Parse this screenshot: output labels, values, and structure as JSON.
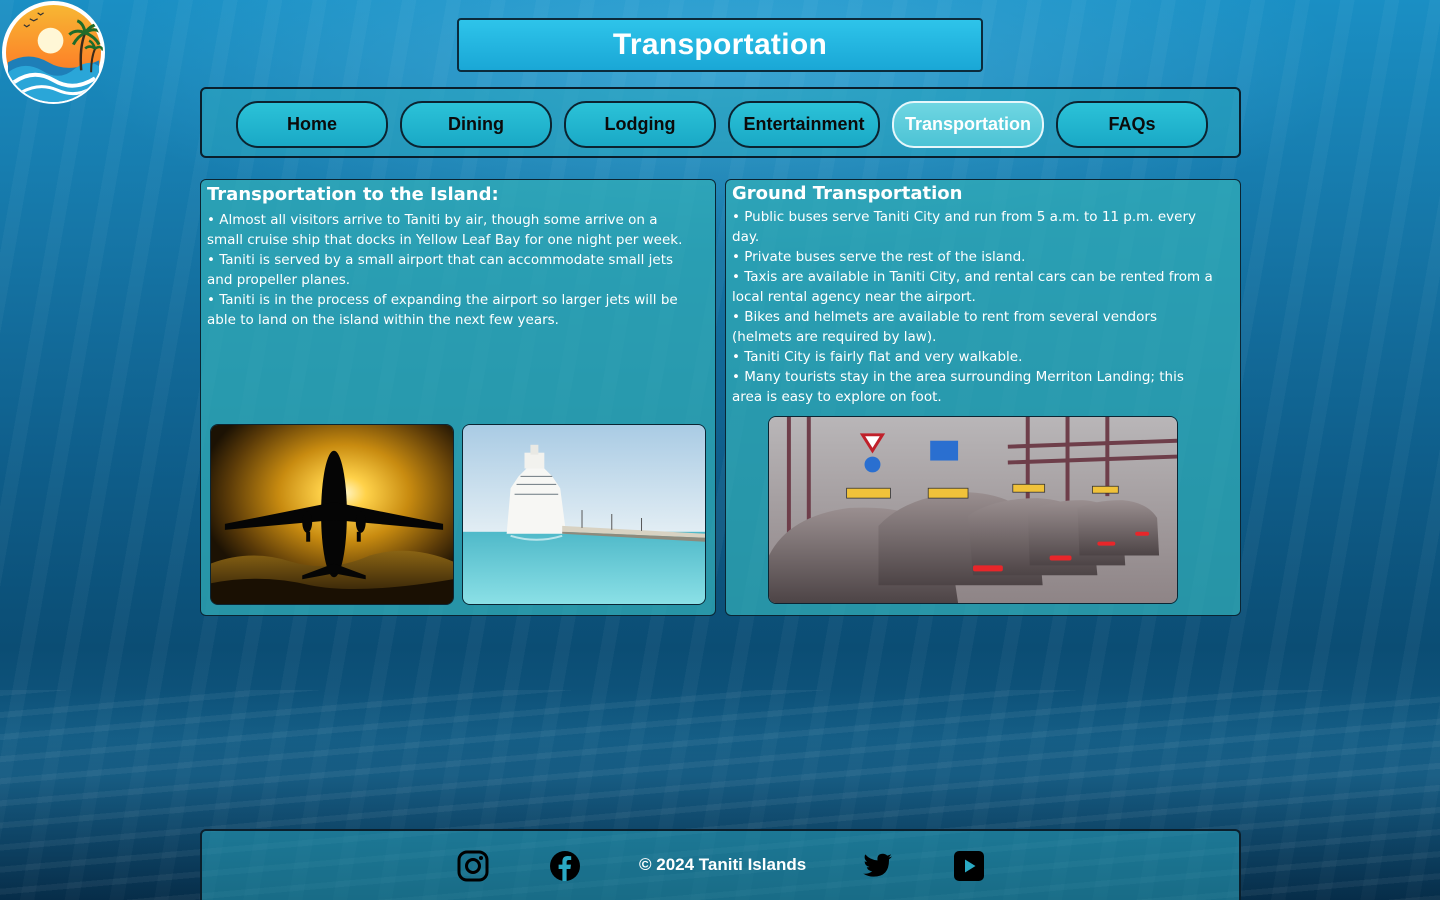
{
  "page": {
    "title": "Transportation"
  },
  "nav": {
    "items": [
      {
        "label": "Home"
      },
      {
        "label": "Dining"
      },
      {
        "label": "Lodging"
      },
      {
        "label": "Entertainment"
      },
      {
        "label": "Transportation",
        "active": true
      },
      {
        "label": "FAQs"
      }
    ]
  },
  "island_section": {
    "heading": "Transportation to the Island:",
    "bullets": [
      "• Almost all visitors arrive to Taniti by air, though some arrive on a small cruise ship that docks in Yellow Leaf Bay for one night per week.",
      "• Taniti is served by a small airport that can accommodate small jets and propeller planes.",
      "• Taniti is in the process of expanding the airport so larger jets will be able to land on the island within the next few years."
    ]
  },
  "ground_section": {
    "heading": "Ground Transportation",
    "bullets": [
      "• Public buses serve Taniti City and run from 5 a.m. to 11 p.m. every day.",
      "• Private buses serve the rest of the island.",
      "• Taxis are available in Taniti City, and rental cars can be rented from a local rental agency near the airport.",
      "• Bikes and helmets are available to rent from several vendors (helmets are required by law).",
      "• Taniti City is fairly flat and very walkable.",
      "• Many tourists stay in the area surrounding Merriton Landing; this area is easy to explore on foot."
    ]
  },
  "footer": {
    "copyright": "© 2024 Taniti Islands",
    "social": [
      {
        "icon": "instagram-icon"
      },
      {
        "icon": "facebook-icon"
      },
      {
        "icon": "twitter-icon"
      },
      {
        "icon": "youtube-icon"
      }
    ]
  },
  "colors": {
    "accent": "#1aa9c6",
    "active_nav": "#4cc3d5",
    "panel": "#32afb9",
    "text": "#ffffff"
  }
}
